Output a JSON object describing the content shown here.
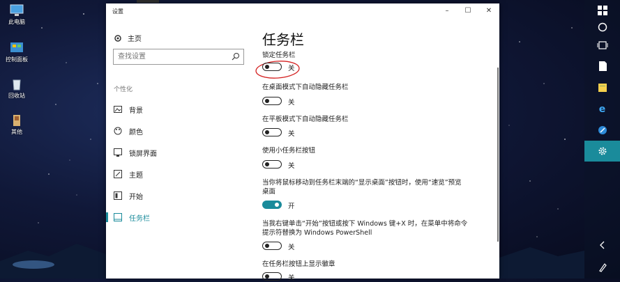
{
  "desktop": {
    "icons": [
      {
        "label": "此电脑",
        "icon": "computer-icon"
      },
      {
        "label": "控制面板",
        "icon": "control-panel-icon"
      },
      {
        "label": "回收站",
        "icon": "recycle-bin-icon"
      },
      {
        "label": "其他",
        "icon": "folder-icon"
      }
    ]
  },
  "window": {
    "title": "设置",
    "controls": {
      "minimize": "–",
      "maximize": "☐",
      "close": "✕"
    }
  },
  "nav": {
    "home_label": "主页",
    "search_placeholder": "查找设置",
    "section": "个性化",
    "items": [
      {
        "label": "背景",
        "icon": "image-icon",
        "active": false
      },
      {
        "label": "颜色",
        "icon": "palette-icon",
        "active": false
      },
      {
        "label": "锁屏界面",
        "icon": "lock-screen-icon",
        "active": false
      },
      {
        "label": "主题",
        "icon": "theme-icon",
        "active": false
      },
      {
        "label": "开始",
        "icon": "start-icon",
        "active": false
      },
      {
        "label": "任务栏",
        "icon": "taskbar-icon",
        "active": true
      }
    ]
  },
  "content": {
    "title": "任务栏",
    "settings": [
      {
        "label": "锁定任务栏",
        "state": "关",
        "on": false
      },
      {
        "label": "在桌面模式下自动隐藏任务栏",
        "state": "关",
        "on": false
      },
      {
        "label": "在平板模式下自动隐藏任务栏",
        "state": "关",
        "on": false
      },
      {
        "label": "使用小任务栏按钮",
        "state": "关",
        "on": false
      },
      {
        "label": "当你将鼠标移动到任务栏末端的“显示桌面”按钮时，使用“速览”预览桌面",
        "state": "开",
        "on": true
      },
      {
        "label": "当我右键单击“开始”按钮或按下 Windows 键+X 时，在菜单中将命令提示符替换为 Windows PowerShell",
        "state": "关",
        "on": false
      },
      {
        "label": "在任务栏按钮上显示徽章",
        "state": "关",
        "on": false
      }
    ]
  },
  "colors": {
    "accent": "#1a8b9b",
    "annotation": "#d42020"
  },
  "action_panel": {
    "icons": [
      "windows-icon",
      "circle-icon",
      "task-view-icon",
      "document-icon",
      "sticky-note-icon",
      "edge-icon",
      "app-icon",
      "settings-icon",
      "chevron-left-icon",
      "pen-icon"
    ]
  }
}
